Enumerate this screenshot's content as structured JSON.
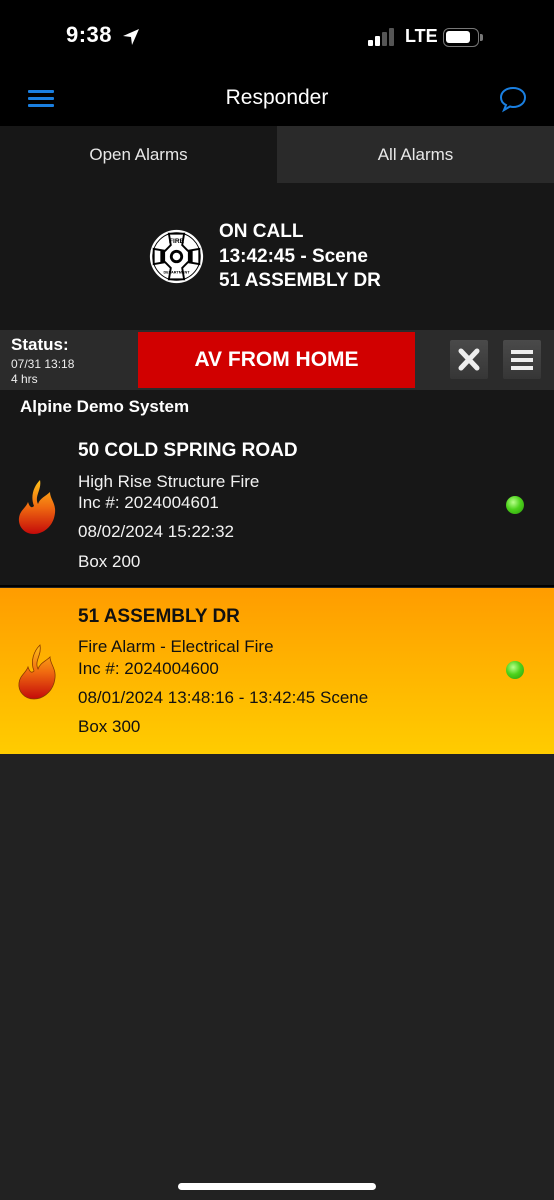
{
  "status_bar": {
    "time": "9:38",
    "location_icon": "location-arrow-icon",
    "signal_icon": "cellular-signal-icon",
    "signal_bars_active": 2,
    "signal_bars_total": 4,
    "network": "LTE",
    "battery_icon": "battery-icon",
    "battery_level": 0.75
  },
  "nav": {
    "menu_icon": "hamburger-menu-icon",
    "title": "Responder",
    "chat_icon": "chat-bubble-icon",
    "accent_color": "#1a7fe0"
  },
  "tabs": [
    {
      "label": "Open Alarms",
      "active": true
    },
    {
      "label": "All Alarms",
      "active": false
    }
  ],
  "on_call": {
    "logo_icon": "fire-department-badge-icon",
    "line1": "ON CALL",
    "line2": "13:42:45 - Scene",
    "line3": "51 ASSEMBLY DR"
  },
  "status": {
    "label": "Status:",
    "date": "07/31 13:18",
    "duration": "4 hrs",
    "button_label": "AV FROM HOME",
    "button_color": "#d10000",
    "close_icon": "close-x-icon",
    "list_icon": "list-menu-icon"
  },
  "system": {
    "name": "Alpine Demo System"
  },
  "alarms": [
    {
      "title": "50 COLD SPRING ROAD",
      "type": "High Rise Structure Fire",
      "incident": "Inc #: 2024004601",
      "datetime": "08/02/2024 15:22:32",
      "box": "Box 200",
      "icon": "flame-icon",
      "status_dot": "green-status-dot",
      "highlighted": false
    },
    {
      "title": "51 ASSEMBLY DR",
      "type": "Fire Alarm - Electrical Fire",
      "incident": "Inc #: 2024004600",
      "datetime": "08/01/2024 13:48:16 - 13:42:45 Scene",
      "box": "Box 300",
      "icon": "flame-icon",
      "status_dot": "green-status-dot",
      "highlighted": true,
      "highlight_color": "#ffb200"
    }
  ]
}
